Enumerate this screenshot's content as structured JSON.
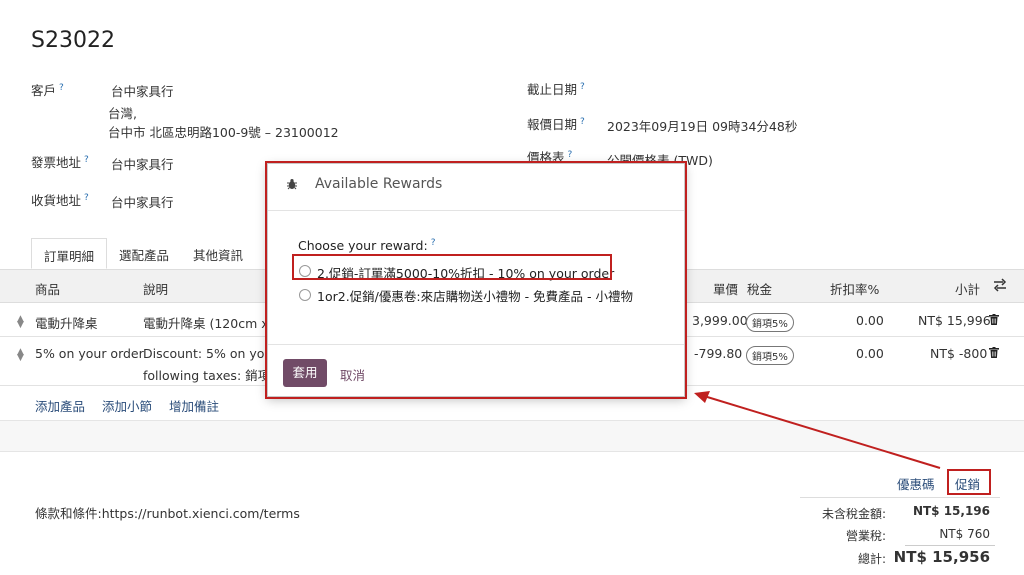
{
  "order": {
    "number": "S23022",
    "customer_label": "客戶",
    "customer_name": "台中家具行",
    "customer_country": "台灣,",
    "customer_address": "台中市 北區忠明路100-9號 – 23100012",
    "invoice_label": "發票地址",
    "invoice_value": "台中家具行",
    "delivery_label": "收貨地址",
    "delivery_value": "台中家具行",
    "expiry_label": "截止日期",
    "quote_date_label": "報價日期",
    "quote_date_value": "2023年09月19日 09時34分48秒",
    "pricelist_label": "價格表",
    "pricelist_value": "公開價格表 (TWD)",
    "help_mark": "?"
  },
  "tabs": [
    "訂單明細",
    "選配產品",
    "其他資訊"
  ],
  "table": {
    "headers": {
      "product": "商品",
      "description": "說明",
      "unit_price": "單價",
      "taxes": "稅金",
      "discount": "折扣率%",
      "subtotal": "小計"
    },
    "rows": [
      {
        "product": "電動升降桌",
        "description": "電動升降桌 (120cm x 6",
        "unit_price": "3,999.00",
        "tax": "銷項5%",
        "discount": "0.00",
        "subtotal": "NT$ 15,996"
      },
      {
        "product": "5% on your order",
        "description": "Discount: 5% on your",
        "description2": "following taxes: 銷項5",
        "unit_price": "-799.80",
        "tax": "銷項5%",
        "discount": "0.00",
        "subtotal": "NT$ -800"
      }
    ],
    "add_product": "添加產品",
    "add_section": "添加小節",
    "add_note": "增加備註"
  },
  "footer": {
    "coupon_button": "優惠碼",
    "promotion_button": "促銷",
    "terms": "條款和條件:https://runbot.xienci.com/terms",
    "untaxed_label": "未含稅金額:",
    "untaxed_value": "NT$ 15,196",
    "tax_label": "營業稅:",
    "tax_value": "NT$ 760",
    "total_label": "總計:",
    "total_value": "NT$ 15,956"
  },
  "modal": {
    "title": "Available Rewards",
    "choose_label": "Choose your reward:",
    "help_mark": "?",
    "options": [
      "2.促銷-訂單滿5000-10%折扣 - 10% on your order",
      "1or2.促銷/優惠卷:來店購物送小禮物 - 免費產品 - 小禮物"
    ],
    "apply": "套用",
    "cancel": "取消"
  },
  "colors": {
    "brand": "#714b67",
    "annotation": "#c0201f"
  }
}
